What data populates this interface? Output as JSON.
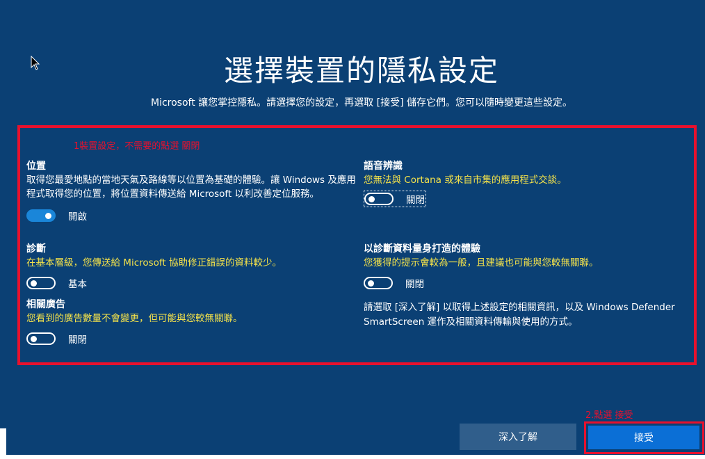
{
  "header": {
    "title": "選擇裝置的隱私設定",
    "subtitle": "Microsoft 讓您掌控隱私。請選擇您的設定，再選取 [接受] 儲存它們。您可以隨時變更這些設定。"
  },
  "annotations": {
    "step1": "1裝置設定，不需要的點選 關閉",
    "step2": "2.點選 接受"
  },
  "settings": {
    "location": {
      "title": "位置",
      "description": "取得您最愛地點的當地天氣及路線等以位置為基礎的體驗。讓 Windows 及應用程式取得您的位置，將位置資料傳送給 Microsoft 以利改善定位服務。",
      "toggle_state": "開啟",
      "enabled": true
    },
    "speech": {
      "title": "語音辨識",
      "description": "您無法與 Cortana 或來自市集的應用程式交談。",
      "toggle_state": "關閉",
      "enabled": false
    },
    "diagnostics": {
      "title": "診斷",
      "description": "在基本層級，您傳送給 Microsoft 協助修正錯誤的資料較少。",
      "toggle_state": "基本",
      "enabled": false
    },
    "tailored": {
      "title": "以診斷資料量身打造的體驗",
      "description": "您獲得的提示會較為一般，且建議也可能與您較無關聯。",
      "toggle_state": "關閉",
      "enabled": false
    },
    "ads": {
      "title": "相關廣告",
      "description": "您看到的廣告數量不會變更，但可能與您較無關聯。",
      "toggle_state": "關閉",
      "enabled": false
    }
  },
  "info_text": {
    "line1": "請選取 [深入了解] 以取得上述設定的相關資訊，以及 Windows Defender",
    "line2": "SmartScreen 運作及相關資料傳輸與使用的方式。"
  },
  "buttons": {
    "learn_more": "深入了解",
    "accept": "接受"
  },
  "colors": {
    "background": "#0b4074",
    "accent": "#1a86d9",
    "highlight_red": "#e8112d",
    "description_yellow": "#f4e24a",
    "accept_button": "#0b6fd6",
    "learn_button": "#305e8b"
  },
  "icons": {
    "cursor": "mouse-pointer-icon"
  }
}
